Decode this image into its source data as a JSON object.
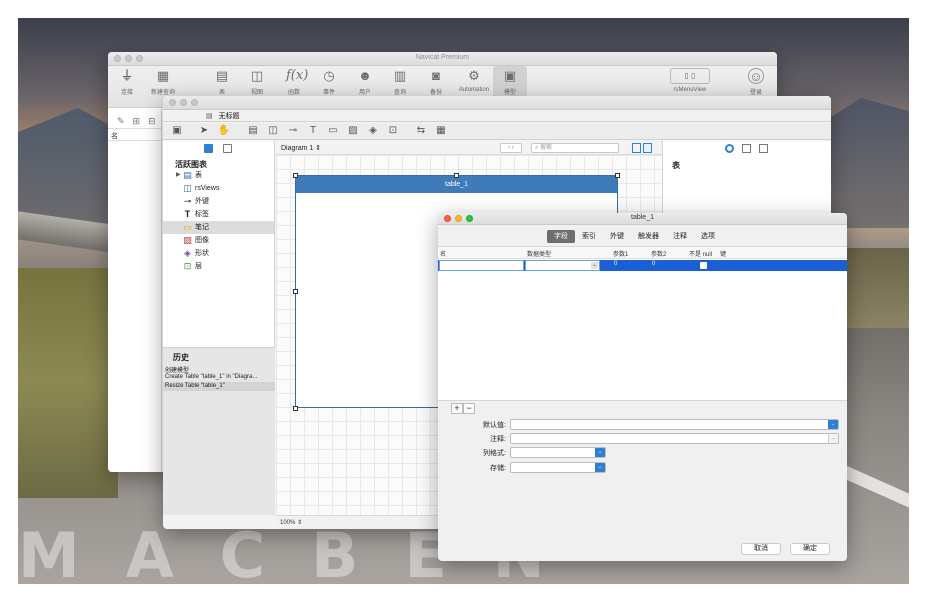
{
  "main_window": {
    "title": "Navicat Premium",
    "toolbar": [
      {
        "label": "连接",
        "icon": "plug-icon"
      },
      {
        "label": "新建查询",
        "icon": "new-query-icon"
      },
      {
        "label": "表",
        "icon": "table-icon"
      },
      {
        "label": "视图",
        "icon": "view-icon"
      },
      {
        "label": "函数",
        "icon": "function-icon"
      },
      {
        "label": "事件",
        "icon": "clock-icon"
      },
      {
        "label": "用户",
        "icon": "user-icon"
      },
      {
        "label": "查询",
        "icon": "query-icon"
      },
      {
        "label": "备份",
        "icon": "backup-icon"
      },
      {
        "label": "Automation",
        "icon": "automation-icon"
      },
      {
        "label": "模型",
        "icon": "model-icon"
      }
    ],
    "right_toolbar": {
      "view_label": "rsMenuView",
      "login_label": "登录"
    },
    "sidebar_header": "名"
  },
  "model_window": {
    "tab_title": "无标题",
    "palette_title": "活跃图表",
    "palette": [
      {
        "label": "表",
        "icon": "table-icon"
      },
      {
        "label": "rsViews",
        "icon": "view-icon"
      },
      {
        "label": "外键",
        "icon": "foreign-key-icon"
      },
      {
        "label": "标签",
        "icon": "text-icon"
      },
      {
        "label": "笔记",
        "icon": "note-icon"
      },
      {
        "label": "图像",
        "icon": "image-icon"
      },
      {
        "label": "形状",
        "icon": "shape-icon"
      },
      {
        "label": "层",
        "icon": "layer-icon"
      }
    ],
    "history_title": "历史",
    "history": [
      "创建模型",
      "Create Table \"table_1\" in \"Diagra...",
      "Resize Table \"table_1\""
    ],
    "diagram_select": "Diagram 1",
    "search_placeholder": "搜索",
    "table_shape_title": "table_1",
    "zoom": "100%",
    "properties_title": "表"
  },
  "dialog": {
    "title": "table_1",
    "tabs": [
      "字段",
      "索引",
      "外键",
      "触发器",
      "注释",
      "选项"
    ],
    "active_tab": "字段",
    "columns": [
      "名",
      "数据类型",
      "参数1",
      "参数2",
      "不是 null",
      "键"
    ],
    "row": {
      "param1": "0",
      "param2": "0"
    },
    "props": {
      "default_label": "默认值:",
      "comment_label": "注释:",
      "format_label": "列格式:",
      "storage_label": "存储:"
    },
    "cancel": "取消",
    "ok": "确定"
  }
}
